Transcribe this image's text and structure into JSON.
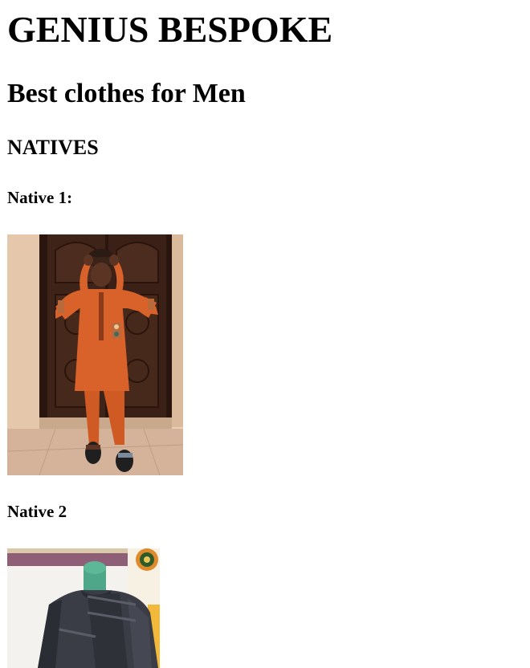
{
  "site": {
    "title": "GENIUS BESPOKE",
    "subtitle": "Best clothes for Men"
  },
  "section": {
    "heading": "NATIVES",
    "items": [
      {
        "label": "Native 1:",
        "image": "man-in-orange-native-outfit-photo"
      },
      {
        "label": "Native 2",
        "image": "grey-native-shirt-on-mannequin-photo"
      }
    ]
  },
  "colors": {
    "outfit_orange": "#d9622a",
    "door_brown": "#3a2016",
    "shirt_grey": "#3c3e47"
  }
}
